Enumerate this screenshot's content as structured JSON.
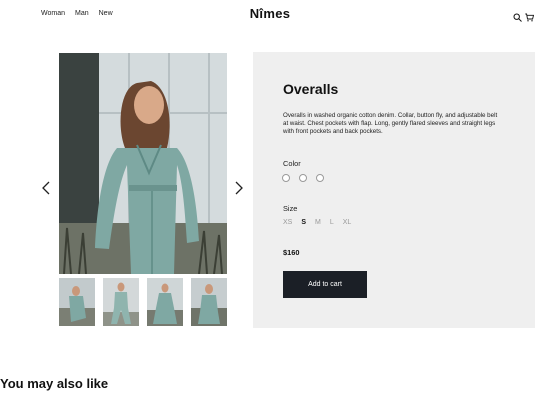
{
  "nav": {
    "items": [
      "Woman",
      "Man",
      "New"
    ]
  },
  "brand": "Nîmes",
  "header_icons": [
    "search-icon",
    "cart-icon"
  ],
  "gallery": {
    "thumbnail_count": 4
  },
  "product": {
    "title": "Overalls",
    "description": "Overalls in washed organic cotton denim. Collar, button fly, and adjustable belt at waist. Chest pockets with flap. Long, gently flared sleeves and straight legs with front pockets and back pockets.",
    "color_label": "Color",
    "size_label": "Size",
    "sizes": [
      "XS",
      "S",
      "M",
      "L",
      "XL"
    ],
    "selected_size": "S",
    "price": "$160",
    "add_to_cart": "Add to cart"
  },
  "related_heading": "You may also like",
  "colors": {
    "panel_bg": "#efefef",
    "button_bg": "#1b1f26",
    "denim": "#7fa8a3"
  }
}
